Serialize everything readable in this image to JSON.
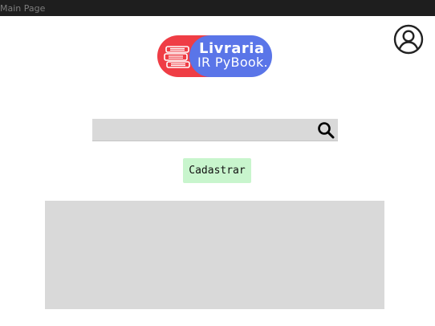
{
  "window": {
    "title": "Main Page"
  },
  "logo": {
    "title": "Livraria",
    "subtitle": "IR PyBook.",
    "icon": "books-icon"
  },
  "header": {
    "account_icon": "user-circle-icon"
  },
  "search": {
    "placeholder": "",
    "icon": "search-icon"
  },
  "actions": {
    "register_label": "Cadastrar"
  },
  "colors": {
    "titlebar": "#1e1e1e",
    "logo_red": "#ef3d45",
    "logo_blue": "#5a75e8",
    "register_button": "#c8f5cd",
    "panel": "#d9d9d9"
  }
}
